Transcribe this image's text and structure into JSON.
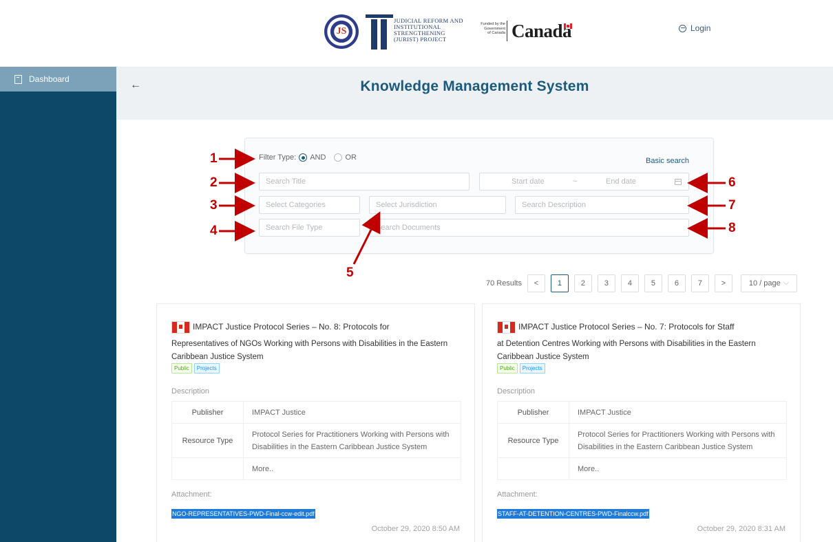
{
  "header": {
    "seal_text": "JS",
    "jurist_lines": [
      "JUDICIAL REFORM AND",
      "INSTITUTIONAL",
      "STRENGTHENING",
      "(JURIST) PROJECT"
    ],
    "funded_lines": [
      "Funded by the",
      "Government",
      "of Canada"
    ],
    "canada_wordmark": "Canada",
    "login_label": "Login"
  },
  "sidebar": {
    "items": [
      {
        "label": "Dashboard",
        "icon": "document-icon"
      }
    ]
  },
  "page": {
    "back_icon": "←",
    "title": "Knowledge Management System"
  },
  "filter": {
    "filter_type_label": "Filter Type:",
    "options": [
      "AND",
      "OR"
    ],
    "selected": "AND",
    "basic_search_label": "Basic search",
    "search_title_placeholder": "Search Title",
    "start_date_placeholder": "Start date",
    "date_separator": "~",
    "end_date_placeholder": "End date",
    "categories_placeholder": "Select Categories",
    "jurisdiction_placeholder": "Select Jurisdiction",
    "description_placeholder": "Search Description",
    "file_type_placeholder": "Search File Type",
    "documents_placeholder": "Search Documents"
  },
  "annotations": [
    "1",
    "2",
    "3",
    "4",
    "5",
    "6",
    "7",
    "8"
  ],
  "pagination": {
    "results_label": "70 Results",
    "prev": "<",
    "pages": [
      "1",
      "2",
      "3",
      "4",
      "5",
      "6",
      "7"
    ],
    "current_page": "1",
    "next": ">",
    "page_size": "10 / page"
  },
  "cards": [
    {
      "title_line1": "IMPACT Justice Protocol Series – No. 8: Protocols for",
      "title_rest": "Representatives of NGOs Working with Persons with Disabilities in the Eastern Caribbean Justice System",
      "tags": [
        "Public",
        "Projects"
      ],
      "description_label": "Description",
      "rows": [
        {
          "key": "Publisher",
          "value": "IMPACT Justice"
        },
        {
          "key": "Resource Type",
          "value": "Protocol Series for Practitioners Working with Persons with Disabilities in the Eastern Caribbean Justice System"
        },
        {
          "key": "",
          "value": "More.."
        }
      ],
      "attachment_label": "Attachment:",
      "attachment_file": "NGO-REPRESENTATIVES-PWD-Final-ccw-edit.pdf",
      "date": "October 29, 2020 8:50 AM"
    },
    {
      "title_line1": "IMPACT Justice Protocol Series – No. 7: Protocols for Staff",
      "title_rest": "at Detention Centres Working with Persons with Disabilities in the Eastern Caribbean Justice System",
      "tags": [
        "Public",
        "Projects"
      ],
      "description_label": "Description",
      "rows": [
        {
          "key": "Publisher",
          "value": "IMPACT Justice"
        },
        {
          "key": "Resource Type",
          "value": "Protocol Series for Practitioners Working with Persons with Disabilities in the Eastern Caribbean Justice System"
        },
        {
          "key": "",
          "value": "More.."
        }
      ],
      "attachment_label": "Attachment:",
      "attachment_file": "STAFF-AT-DETENTION-CENTRES-PWD-Finalccw.pdf",
      "date": "October 29, 2020 8:31 AM"
    }
  ],
  "colors": {
    "sidebar_bg": "#0d4868",
    "sidebar_active": "#7ca2ba",
    "title": "#1b5a7c",
    "annotation": "#c00000",
    "attachment_bg": "#1f7ad8"
  }
}
